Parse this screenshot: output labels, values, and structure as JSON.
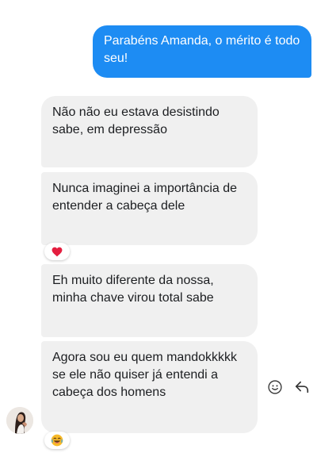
{
  "messages": {
    "outgoing": {
      "text": "Parabéns Amanda, o mérito é todo seu!"
    },
    "incoming": [
      {
        "text": "Não não eu estava desistindo sabe, em depressão"
      },
      {
        "text": "Nunca imaginei a importância de entender a cabeça dele",
        "reaction": "heart-icon"
      },
      {
        "text": "Eh muito diferente da nossa, minha chave virou total sabe"
      },
      {
        "text": "Agora sou eu quem mandokkkkk se ele não quiser já entendi a cabeça dos homens",
        "reaction": "laughing-face-icon"
      }
    ]
  },
  "colors": {
    "outgoing_bubble": "#1d8cf3",
    "incoming_bubble": "#f0f0f0",
    "heart": "#e41e3f",
    "emoji_face": "#f7b928"
  },
  "icons": {
    "react": "smiley-icon",
    "reply": "reply-arrow-icon"
  }
}
